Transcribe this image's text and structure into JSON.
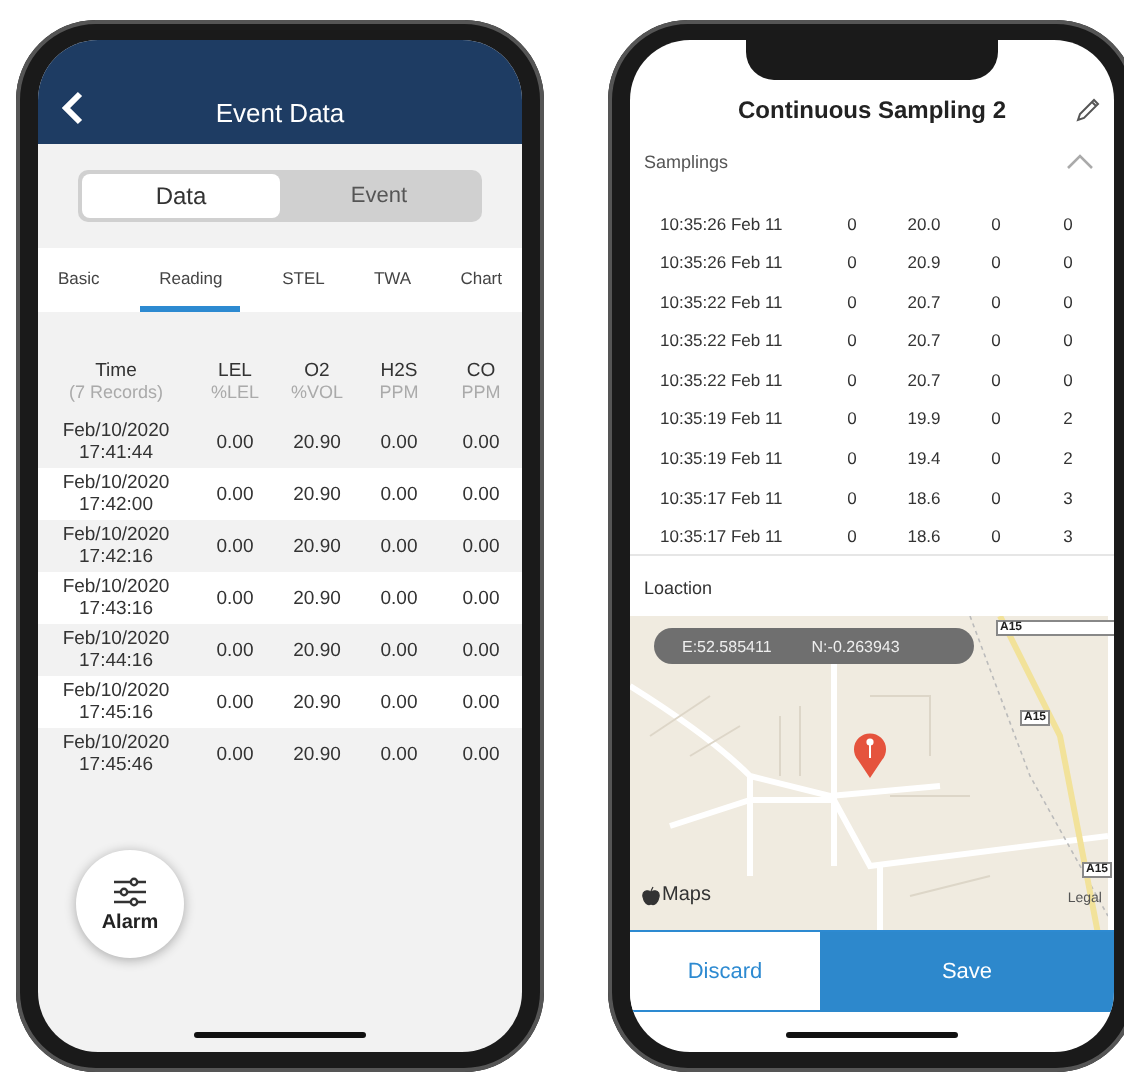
{
  "left_phone": {
    "header": {
      "title": "Event Data"
    },
    "segments": [
      {
        "label": "Data",
        "selected": true
      },
      {
        "label": "Event",
        "selected": false
      }
    ],
    "tabs": [
      {
        "label": "Basic",
        "selected": false
      },
      {
        "label": "Reading",
        "selected": true
      },
      {
        "label": "STEL",
        "selected": false
      },
      {
        "label": "TWA",
        "selected": false
      },
      {
        "label": "Chart",
        "selected": false
      }
    ],
    "table": {
      "columns": [
        {
          "name": "Time",
          "unit": "(7 Records)"
        },
        {
          "name": "LEL",
          "unit": "%LEL"
        },
        {
          "name": "O2",
          "unit": "%VOL"
        },
        {
          "name": "H2S",
          "unit": "PPM"
        },
        {
          "name": "CO",
          "unit": "PPM"
        }
      ],
      "rows": [
        [
          "Feb/10/2020 17:41:44",
          "0.00",
          "20.90",
          "0.00",
          "0.00"
        ],
        [
          "Feb/10/2020 17:42:00",
          "0.00",
          "20.90",
          "0.00",
          "0.00"
        ],
        [
          "Feb/10/2020 17:42:16",
          "0.00",
          "20.90",
          "0.00",
          "0.00"
        ],
        [
          "Feb/10/2020 17:43:16",
          "0.00",
          "20.90",
          "0.00",
          "0.00"
        ],
        [
          "Feb/10/2020 17:44:16",
          "0.00",
          "20.90",
          "0.00",
          "0.00"
        ],
        [
          "Feb/10/2020 17:45:16",
          "0.00",
          "20.90",
          "0.00",
          "0.00"
        ],
        [
          "Feb/10/2020 17:45:46",
          "0.00",
          "20.90",
          "0.00",
          "0.00"
        ]
      ]
    },
    "fab": {
      "label": "Alarm"
    }
  },
  "right_phone": {
    "title": "Continuous Sampling 2",
    "samplings": {
      "label": "Samplings",
      "expanded": true,
      "rows": [
        [
          "10:35:26 Feb 11",
          "0",
          "20.0",
          "0",
          "0"
        ],
        [
          "10:35:26 Feb 11",
          "0",
          "20.9",
          "0",
          "0"
        ],
        [
          "10:35:22 Feb 11",
          "0",
          "20.7",
          "0",
          "0"
        ],
        [
          "10:35:22 Feb 11",
          "0",
          "20.7",
          "0",
          "0"
        ],
        [
          "10:35:22 Feb 11",
          "0",
          "20.7",
          "0",
          "0"
        ],
        [
          "10:35:19 Feb 11",
          "0",
          "19.9",
          "0",
          "2"
        ],
        [
          "10:35:19 Feb 11",
          "0",
          "19.4",
          "0",
          "2"
        ],
        [
          "10:35:17 Feb 11",
          "0",
          "18.6",
          "0",
          "3"
        ],
        [
          "10:35:17 Feb 11",
          "0",
          "18.6",
          "0",
          "3"
        ]
      ]
    },
    "location": {
      "label": "Loaction",
      "easting": "E:52.585411",
      "northing": "N:-0.263943",
      "attribution": "Maps",
      "legal": "Legal",
      "road_signs": [
        "A15",
        "A15",
        "A15"
      ]
    },
    "buttons": [
      {
        "label": "Discard",
        "kind": "secondary"
      },
      {
        "label": "Save",
        "kind": "primary"
      }
    ]
  }
}
